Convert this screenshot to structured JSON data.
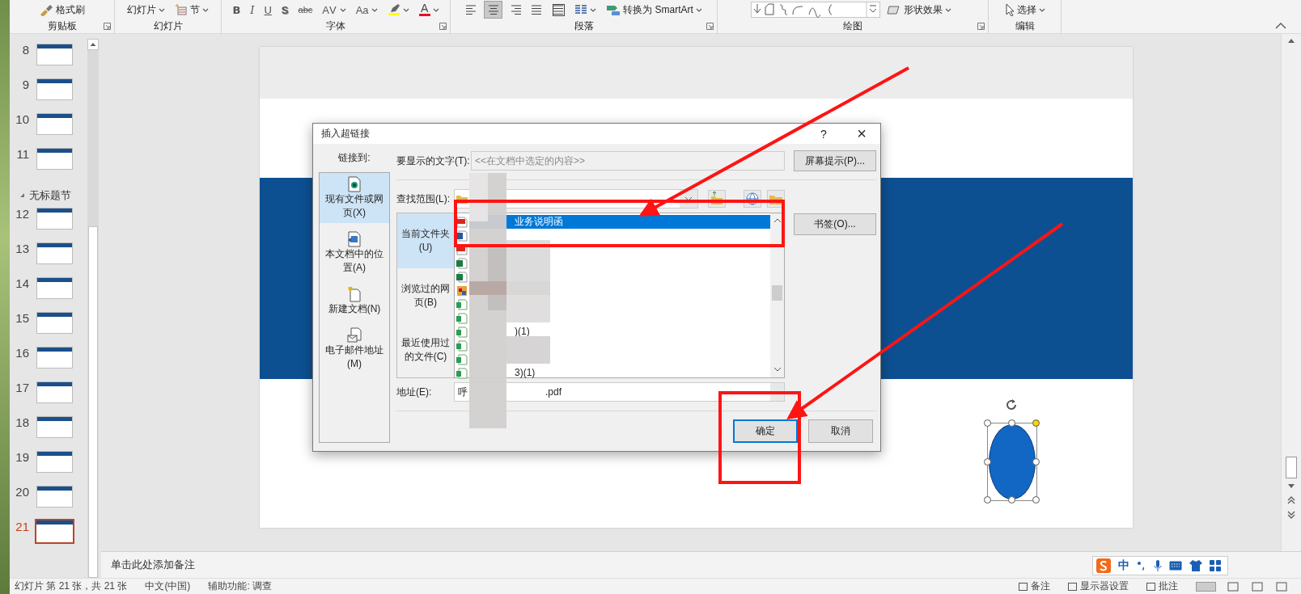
{
  "ribbon": {
    "groups": [
      {
        "label": "剪贴板",
        "controls": [
          {
            "kind": "button",
            "text": "格式刷"
          }
        ]
      },
      {
        "label": "幻灯片",
        "controls": [
          {
            "kind": "button",
            "text": "幻灯片"
          },
          {
            "kind": "button",
            "text": "节"
          }
        ]
      },
      {
        "label": "字体",
        "controls": [
          {
            "kind": "format",
            "text": "B"
          },
          {
            "kind": "format",
            "text": "I"
          },
          {
            "kind": "format",
            "text": "U"
          },
          {
            "kind": "format",
            "text": "S"
          },
          {
            "kind": "format",
            "text": "abc"
          },
          {
            "kind": "format",
            "text": "AV"
          },
          {
            "kind": "format",
            "text": "Aa"
          },
          {
            "kind": "color",
            "color": "#ffff00"
          },
          {
            "kind": "color",
            "text": "A",
            "color": "#e81123"
          }
        ]
      },
      {
        "label": "段落",
        "controls": [
          {
            "kind": "align",
            "selected": false
          },
          {
            "kind": "align",
            "selected": true
          },
          {
            "kind": "align",
            "selected": false
          },
          {
            "kind": "align",
            "selected": false
          },
          {
            "kind": "align",
            "selected": false
          },
          {
            "kind": "icon"
          },
          {
            "kind": "button",
            "text": "转换为 SmartArt"
          }
        ]
      },
      {
        "label": "绘图",
        "controls": [
          {
            "kind": "gallery"
          },
          {
            "kind": "button",
            "text": "形状效果"
          }
        ]
      },
      {
        "label": "编辑",
        "controls": [
          {
            "kind": "button",
            "text": "选择"
          }
        ]
      }
    ]
  },
  "slides_panel": {
    "items": [
      {
        "kind": "slide",
        "number": "8",
        "selected": false
      },
      {
        "kind": "slide",
        "number": "9",
        "selected": false
      },
      {
        "kind": "slide",
        "number": "10",
        "selected": false
      },
      {
        "kind": "slide",
        "number": "11",
        "selected": false
      },
      {
        "kind": "section",
        "title": "无标题节",
        "expanded": true
      },
      {
        "kind": "slide",
        "number": "12",
        "selected": false
      },
      {
        "kind": "slide",
        "number": "13",
        "selected": false
      },
      {
        "kind": "slide",
        "number": "14",
        "selected": false
      },
      {
        "kind": "slide",
        "number": "15",
        "selected": false
      },
      {
        "kind": "slide",
        "number": "16",
        "selected": false
      },
      {
        "kind": "slide",
        "number": "17",
        "selected": false
      },
      {
        "kind": "slide",
        "number": "18",
        "selected": false
      },
      {
        "kind": "slide",
        "number": "19",
        "selected": false
      },
      {
        "kind": "slide",
        "number": "20",
        "selected": false
      },
      {
        "kind": "slide",
        "number": "21",
        "selected": true
      }
    ]
  },
  "dialog": {
    "title": "插入超链接",
    "help": "?",
    "close": "×",
    "link_to": {
      "label": "链接到:",
      "items": [
        {
          "label": "现有文件或网页(X)",
          "selected": true
        },
        {
          "label": "本文档中的位置(A)",
          "selected": false
        },
        {
          "label": "新建文档(N)",
          "selected": false
        },
        {
          "label": "电子邮件地址(M)",
          "selected": false
        }
      ]
    },
    "display_text": {
      "label": "要显示的文字(T):",
      "value": "<<在文档中选定的内容>>",
      "disabled": true
    },
    "screen_tip_button": "屏幕提示(P)...",
    "look_in": {
      "label": "查找范围(L):"
    },
    "tabs": [
      {
        "label": "当前文件夹(U)",
        "selected": true
      },
      {
        "label": "浏览过的网页(B)",
        "selected": false
      },
      {
        "label": "最近使用过的文件(C)",
        "selected": false
      }
    ],
    "files": [
      {
        "kind": "pdf",
        "selected": true,
        "name": "业务说明函"
      },
      {
        "kind": "word",
        "selected": false
      },
      {
        "kind": "pdf",
        "selected": false
      },
      {
        "kind": "excel",
        "selected": false
      },
      {
        "kind": "excel",
        "selected": false
      },
      {
        "kind": "image",
        "selected": false
      },
      {
        "kind": "sheet",
        "selected": false
      },
      {
        "kind": "sheet",
        "selected": false
      },
      {
        "kind": "sheet",
        "selected": false,
        "name": ")(1)"
      },
      {
        "kind": "sheet",
        "selected": false
      },
      {
        "kind": "sheet",
        "selected": false
      },
      {
        "kind": "sheet",
        "selected": false,
        "name": "3)(1)"
      }
    ],
    "bookmark_button": "书签(O)...",
    "address": {
      "label": "地址(E):",
      "value_start": "呼",
      "value_end": ".pdf"
    },
    "buttons": [
      {
        "label": "确定",
        "default": true
      },
      {
        "label": "取消",
        "default": false
      }
    ]
  },
  "notes": {
    "placeholder": "单击此处添加备注"
  },
  "status_bar": {
    "left": [
      "幻灯片 第 21 张，共 21 张",
      "中文(中国)",
      "辅助功能: 调查"
    ],
    "right": [
      "备注",
      "显示器设置",
      "批注"
    ]
  },
  "ime": {
    "mode": "中"
  }
}
